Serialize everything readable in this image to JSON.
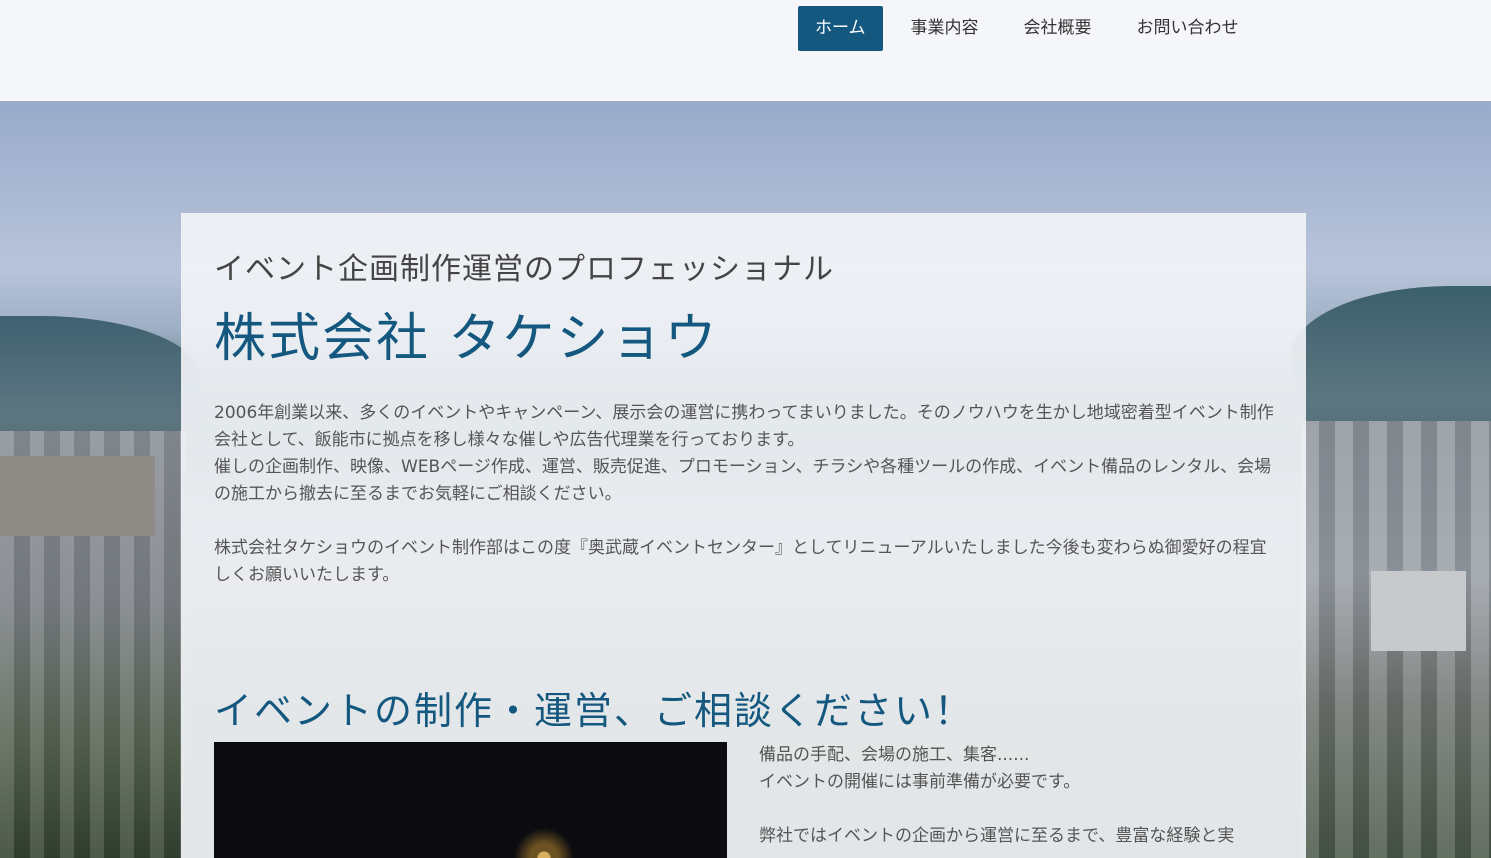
{
  "nav": {
    "items": [
      {
        "label": "ホーム",
        "active": true
      },
      {
        "label": "事業内容",
        "active": false
      },
      {
        "label": "会社概要",
        "active": false
      },
      {
        "label": "お問い合わせ",
        "active": false
      }
    ]
  },
  "hero": {
    "subtitle": "イベント企画制作運営のプロフェッショナル",
    "title": "株式会社 タケショウ",
    "paragraphs": [
      "2006年創業以来、多くのイベントやキャンペーン、展示会の運営に携わってまいりました。そのノウハウを生かし地域密着型イベント制作会社として、飯能市に拠点を移し様々な催しや広告代理業を行っております。\n催しの企画制作、映像、WEBページ作成、運営、販売促進、プロモーション、チラシや各種ツールの作成、イベント備品のレンタル、会場の施工から撤去に至るまでお気軽にご相談ください。",
      "株式会社タケショウのイベント制作部はこの度『奥武蔵イベントセンター』としてリニューアルいたしました今後も変わらぬ御愛好の程宜しくお願いいたします。"
    ]
  },
  "section": {
    "heading": "イベントの制作・運営、ご相談ください！",
    "lines": [
      "備品の手配、会場の施工、集客......",
      "イベントの開催には事前準備が必要です。",
      "",
      "弊社ではイベントの企画から運営に至るまで、豊富な経験と実"
    ]
  },
  "colors": {
    "accent": "#14587f",
    "nav_active_text": "#ffffff"
  }
}
